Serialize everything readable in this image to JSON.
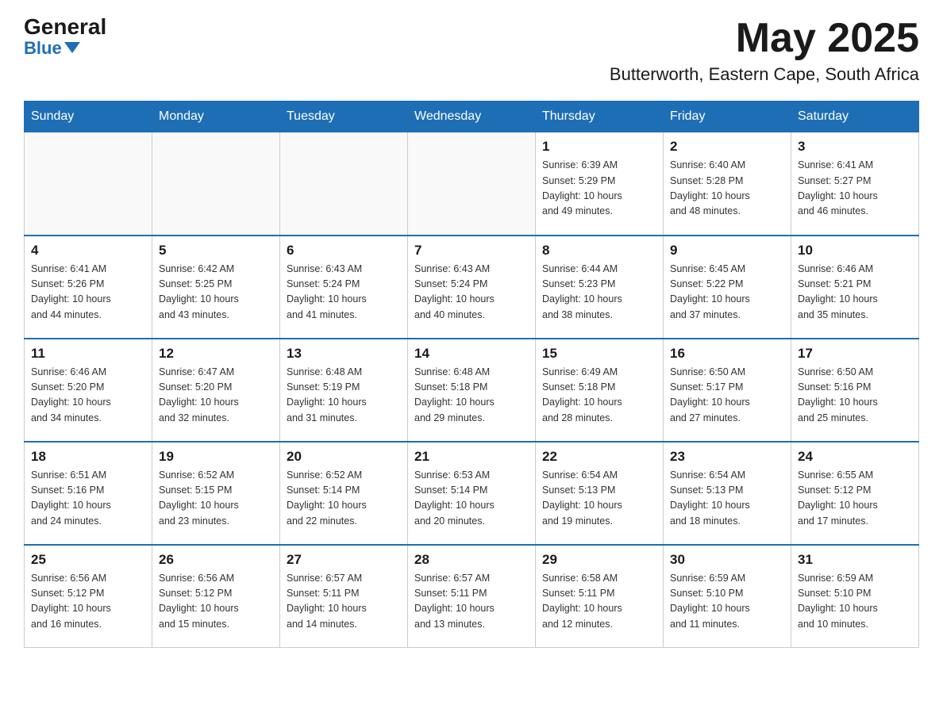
{
  "header": {
    "logo_general": "General",
    "logo_blue": "Blue",
    "month": "May 2025",
    "location": "Butterworth, Eastern Cape, South Africa"
  },
  "days_of_week": [
    "Sunday",
    "Monday",
    "Tuesday",
    "Wednesday",
    "Thursday",
    "Friday",
    "Saturday"
  ],
  "weeks": [
    [
      {
        "day": "",
        "info": ""
      },
      {
        "day": "",
        "info": ""
      },
      {
        "day": "",
        "info": ""
      },
      {
        "day": "",
        "info": ""
      },
      {
        "day": "1",
        "info": "Sunrise: 6:39 AM\nSunset: 5:29 PM\nDaylight: 10 hours\nand 49 minutes."
      },
      {
        "day": "2",
        "info": "Sunrise: 6:40 AM\nSunset: 5:28 PM\nDaylight: 10 hours\nand 48 minutes."
      },
      {
        "day": "3",
        "info": "Sunrise: 6:41 AM\nSunset: 5:27 PM\nDaylight: 10 hours\nand 46 minutes."
      }
    ],
    [
      {
        "day": "4",
        "info": "Sunrise: 6:41 AM\nSunset: 5:26 PM\nDaylight: 10 hours\nand 44 minutes."
      },
      {
        "day": "5",
        "info": "Sunrise: 6:42 AM\nSunset: 5:25 PM\nDaylight: 10 hours\nand 43 minutes."
      },
      {
        "day": "6",
        "info": "Sunrise: 6:43 AM\nSunset: 5:24 PM\nDaylight: 10 hours\nand 41 minutes."
      },
      {
        "day": "7",
        "info": "Sunrise: 6:43 AM\nSunset: 5:24 PM\nDaylight: 10 hours\nand 40 minutes."
      },
      {
        "day": "8",
        "info": "Sunrise: 6:44 AM\nSunset: 5:23 PM\nDaylight: 10 hours\nand 38 minutes."
      },
      {
        "day": "9",
        "info": "Sunrise: 6:45 AM\nSunset: 5:22 PM\nDaylight: 10 hours\nand 37 minutes."
      },
      {
        "day": "10",
        "info": "Sunrise: 6:46 AM\nSunset: 5:21 PM\nDaylight: 10 hours\nand 35 minutes."
      }
    ],
    [
      {
        "day": "11",
        "info": "Sunrise: 6:46 AM\nSunset: 5:20 PM\nDaylight: 10 hours\nand 34 minutes."
      },
      {
        "day": "12",
        "info": "Sunrise: 6:47 AM\nSunset: 5:20 PM\nDaylight: 10 hours\nand 32 minutes."
      },
      {
        "day": "13",
        "info": "Sunrise: 6:48 AM\nSunset: 5:19 PM\nDaylight: 10 hours\nand 31 minutes."
      },
      {
        "day": "14",
        "info": "Sunrise: 6:48 AM\nSunset: 5:18 PM\nDaylight: 10 hours\nand 29 minutes."
      },
      {
        "day": "15",
        "info": "Sunrise: 6:49 AM\nSunset: 5:18 PM\nDaylight: 10 hours\nand 28 minutes."
      },
      {
        "day": "16",
        "info": "Sunrise: 6:50 AM\nSunset: 5:17 PM\nDaylight: 10 hours\nand 27 minutes."
      },
      {
        "day": "17",
        "info": "Sunrise: 6:50 AM\nSunset: 5:16 PM\nDaylight: 10 hours\nand 25 minutes."
      }
    ],
    [
      {
        "day": "18",
        "info": "Sunrise: 6:51 AM\nSunset: 5:16 PM\nDaylight: 10 hours\nand 24 minutes."
      },
      {
        "day": "19",
        "info": "Sunrise: 6:52 AM\nSunset: 5:15 PM\nDaylight: 10 hours\nand 23 minutes."
      },
      {
        "day": "20",
        "info": "Sunrise: 6:52 AM\nSunset: 5:14 PM\nDaylight: 10 hours\nand 22 minutes."
      },
      {
        "day": "21",
        "info": "Sunrise: 6:53 AM\nSunset: 5:14 PM\nDaylight: 10 hours\nand 20 minutes."
      },
      {
        "day": "22",
        "info": "Sunrise: 6:54 AM\nSunset: 5:13 PM\nDaylight: 10 hours\nand 19 minutes."
      },
      {
        "day": "23",
        "info": "Sunrise: 6:54 AM\nSunset: 5:13 PM\nDaylight: 10 hours\nand 18 minutes."
      },
      {
        "day": "24",
        "info": "Sunrise: 6:55 AM\nSunset: 5:12 PM\nDaylight: 10 hours\nand 17 minutes."
      }
    ],
    [
      {
        "day": "25",
        "info": "Sunrise: 6:56 AM\nSunset: 5:12 PM\nDaylight: 10 hours\nand 16 minutes."
      },
      {
        "day": "26",
        "info": "Sunrise: 6:56 AM\nSunset: 5:12 PM\nDaylight: 10 hours\nand 15 minutes."
      },
      {
        "day": "27",
        "info": "Sunrise: 6:57 AM\nSunset: 5:11 PM\nDaylight: 10 hours\nand 14 minutes."
      },
      {
        "day": "28",
        "info": "Sunrise: 6:57 AM\nSunset: 5:11 PM\nDaylight: 10 hours\nand 13 minutes."
      },
      {
        "day": "29",
        "info": "Sunrise: 6:58 AM\nSunset: 5:11 PM\nDaylight: 10 hours\nand 12 minutes."
      },
      {
        "day": "30",
        "info": "Sunrise: 6:59 AM\nSunset: 5:10 PM\nDaylight: 10 hours\nand 11 minutes."
      },
      {
        "day": "31",
        "info": "Sunrise: 6:59 AM\nSunset: 5:10 PM\nDaylight: 10 hours\nand 10 minutes."
      }
    ]
  ]
}
